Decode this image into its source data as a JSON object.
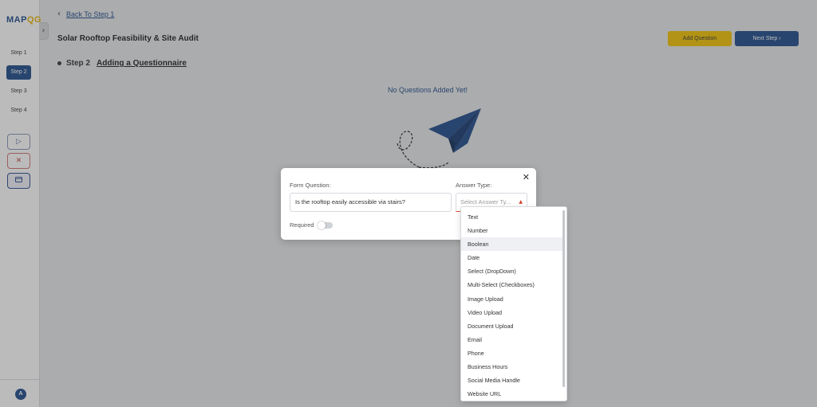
{
  "sidebar": {
    "logo_main": "MAP",
    "logo_accent": "QG",
    "steps": [
      {
        "label": "Step 1",
        "active": false
      },
      {
        "label": "Step 2",
        "active": true
      },
      {
        "label": "Step 3",
        "active": false
      },
      {
        "label": "Step 4",
        "active": false
      }
    ],
    "tools": [
      {
        "icon": "play-icon",
        "glyph": "▷"
      },
      {
        "icon": "close-icon",
        "glyph": "✕"
      },
      {
        "icon": "card-icon",
        "glyph": "▭"
      }
    ],
    "avatar_initial": "A",
    "collapse_glyph": "›"
  },
  "header": {
    "back_label": "Back To Step 1",
    "back_glyph": "‹",
    "title": "Solar Rooftop Feasibility & Site Audit",
    "add_question_label": "Add Question",
    "next_step_label": "Next Step ›"
  },
  "step": {
    "number": "Step 2",
    "name": "Adding a Questionnaire"
  },
  "empty_state": {
    "message": "No Questions Added Yet!"
  },
  "modal": {
    "form_question_label": "Form Question:",
    "question_value": "Is the rooftop easily accessible via stairs?",
    "answer_type_label": "Answer Type:",
    "answer_type_placeholder": "Select Answer Ty...",
    "required_label": "Required",
    "required_on": false,
    "close_glyph": "✕"
  },
  "dropdown": {
    "options": [
      "Text",
      "Number",
      "Boolean",
      "Date",
      "Select (DropDown)",
      "Multi-Select (Checkboxes)",
      "Image Upload",
      "Video Upload",
      "Document Upload",
      "Email",
      "Phone",
      "Business Hours",
      "Social Media Handle",
      "Website URL"
    ],
    "highlighted_index": 2
  },
  "colors": {
    "primary": "#1e4a8a",
    "accent": "#f2c200",
    "error": "#e64c3c"
  }
}
